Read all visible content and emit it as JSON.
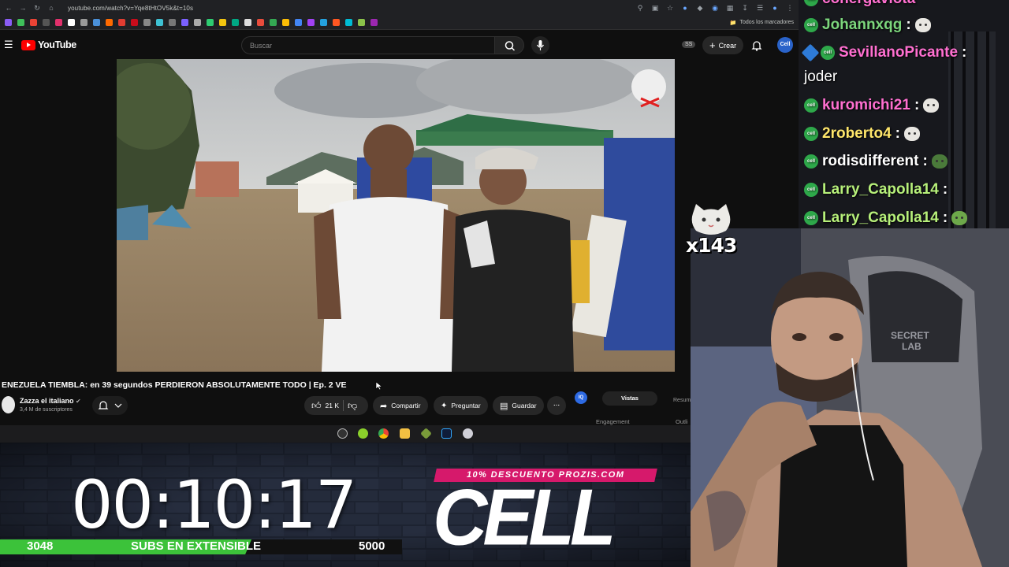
{
  "browser": {
    "url": "youtube.com/watch?v=Yqe8tHtOV5k&t=10s",
    "bookmarks_all": "Todos los marcadores"
  },
  "youtube": {
    "logo_text": "YouTube",
    "search_placeholder": "Buscar",
    "create_label": "Crear",
    "ss_badge": "SS",
    "avatar_text": "Cell"
  },
  "video": {
    "title": "ENEZUELA TIEMBLA: en 39 segundos PERDIERON ABSOLUTAMENTE TODO | Ep. 2 VE",
    "channel": "Zazza el italiano",
    "subscribers": "3,4 M de suscriptores",
    "likes": "21 K",
    "share_label": "Compartir",
    "ask_label": "Preguntar",
    "save_label": "Guardar",
    "more_label": "..."
  },
  "analytics_panel": {
    "badge": "IQ",
    "tab_active": "Vistas",
    "tab_other": "Resum",
    "section_left": "Engagement",
    "section_right": "Outli"
  },
  "overlay": {
    "timer": "00:10:17",
    "subs_current": "3048",
    "subs_label": "SUBS EN EXTENSIBLE",
    "subs_goal": "5000",
    "subs_progress": 0.61,
    "promo_text": "10% DESCUENTO PROZIS.COM",
    "brand": "CELL",
    "emote_count": "x143"
  },
  "chat": {
    "messages": [
      {
        "user": "Johannxqg",
        "text": ":",
        "color": "#7cd67c",
        "badge": "cell",
        "emote": true
      },
      {
        "user": "SevillanoPicante",
        "text": ":",
        "color": "#ff6fd0",
        "badge": "gem+cell",
        "emote": false,
        "continuation": "joder"
      },
      {
        "user": "kuromichi21",
        "text": ":",
        "color": "#ff6fd0",
        "badge": "cell",
        "emote": true
      },
      {
        "user": "2roberto4",
        "text": ":",
        "color": "#ffe66b",
        "badge": "cell",
        "emote": true
      },
      {
        "user": "rodisdifferent",
        "text": ":",
        "color": "#ffffff",
        "badge": "cell",
        "emote": true
      },
      {
        "user": "Larry_Capolla14",
        "text": ":",
        "color": "#b7f07a",
        "badge": "cell",
        "emote": false
      },
      {
        "user": "Larry_Capolla14",
        "text": ":",
        "color": "#b7f07a",
        "badge": "cell",
        "emote": true
      }
    ]
  },
  "colors": {
    "yt_red": "#ff0000",
    "promo_pink": "#d6196b",
    "subs_green": "#3cc23a",
    "cell_badge": "#2ea84a"
  }
}
